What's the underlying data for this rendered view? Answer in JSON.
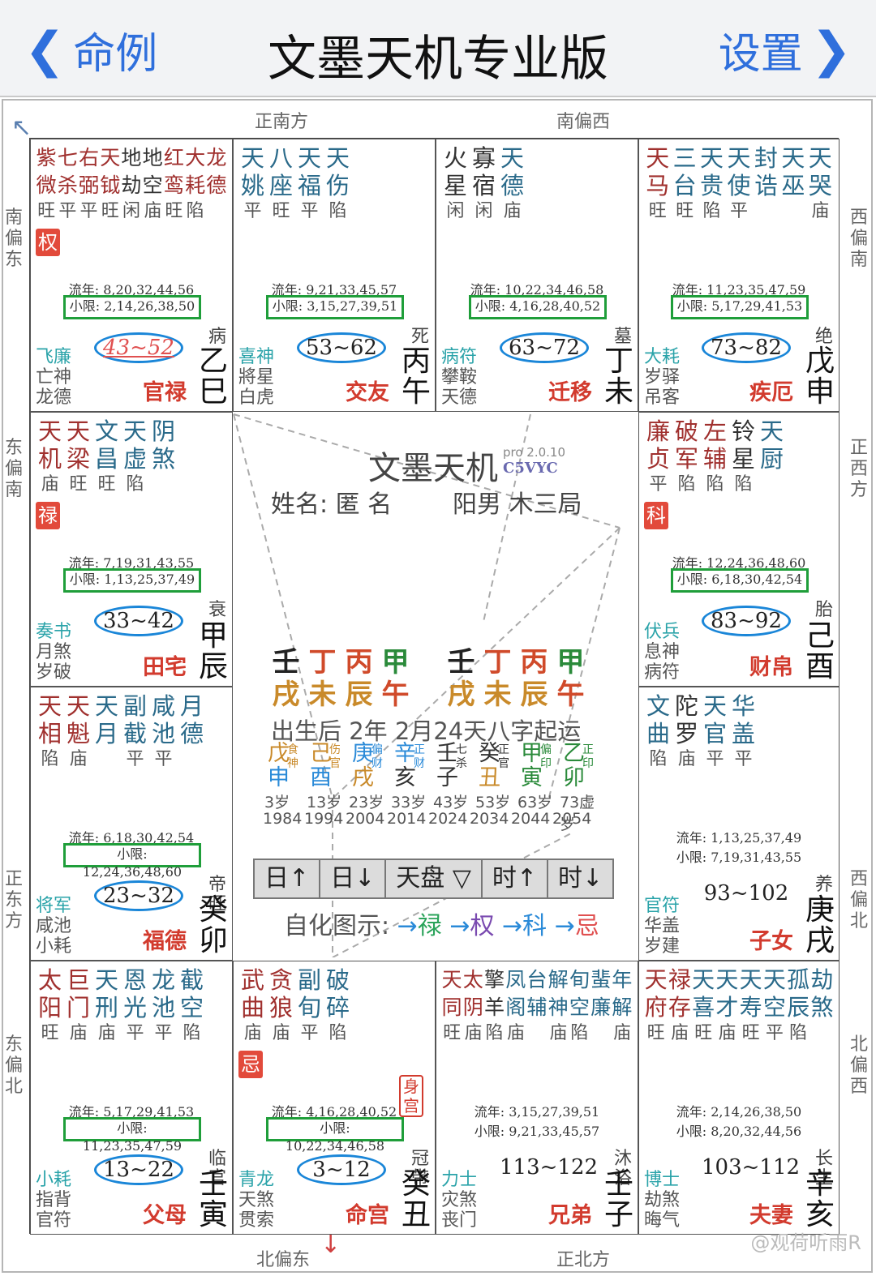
{
  "nav": {
    "back_label": "命例",
    "title": "文墨天机专业版",
    "settings_label": "设置"
  },
  "directions": {
    "top_left": "正南方",
    "top_right": "南偏西",
    "bottom_left": "北偏东",
    "bottom_right": "正北方",
    "left": [
      "南偏东",
      "东偏南",
      "正东方",
      "东偏北"
    ],
    "right": [
      "西偏南",
      "正西方",
      "西偏北",
      "北偏西"
    ]
  },
  "palaces": [
    {
      "id": "si",
      "stars": [
        {
          "c": "紫微",
          "col": "#a0302e"
        },
        {
          "c": "七杀",
          "col": "#a0302e"
        },
        {
          "c": "右弼",
          "col": "#a0302e"
        },
        {
          "c": "天钺",
          "col": "#a0302e"
        },
        {
          "c": "地劫",
          "col": "#333"
        },
        {
          "c": "地空",
          "col": "#333"
        },
        {
          "c": "红鸾",
          "col": "#a0302e"
        },
        {
          "c": "大耗",
          "col": "#a0302e"
        },
        {
          "c": "龙德",
          "col": "#a0302e"
        }
      ],
      "bright": [
        "旺",
        "平",
        "平",
        "旺",
        "闲",
        "庙",
        "旺",
        "陷",
        ""
      ],
      "hua": "权",
      "liunian": "流年: 8,20,32,44,56",
      "xiaoxian": "小限: 2,14,26,38,50",
      "range": "43~52",
      "changsheng": "病",
      "shensha": [
        "飞廉",
        "亡神",
        "龙德"
      ],
      "name": "官禄",
      "gan": "乙",
      "zhi": "巳"
    },
    {
      "id": "wu",
      "stars": [
        {
          "c": "天姚",
          "col": "#2a6a8a"
        },
        {
          "c": "八座",
          "col": "#2a6a8a"
        },
        {
          "c": "天福",
          "col": "#2a6a8a"
        },
        {
          "c": "天伤",
          "col": "#2a6a8a"
        }
      ],
      "bright": [
        "平",
        "旺",
        "平",
        "陷"
      ],
      "liunian": "流年: 9,21,33,45,57",
      "xiaoxian": "小限: 3,15,27,39,51",
      "range": "53~62",
      "changsheng": "死",
      "shensha": [
        "喜神",
        "將星",
        "白虎"
      ],
      "name": "交友",
      "gan": "丙",
      "zhi": "午"
    },
    {
      "id": "wei",
      "stars": [
        {
          "c": "火星",
          "col": "#333"
        },
        {
          "c": "寡宿",
          "col": "#333"
        },
        {
          "c": "天德",
          "col": "#2a6a8a"
        }
      ],
      "bright": [
        "闲",
        "闲",
        "庙"
      ],
      "liunian": "流年: 10,22,34,46,58",
      "xiaoxian": "小限: 4,16,28,40,52",
      "range": "63~72",
      "changsheng": "墓",
      "shensha": [
        "病符",
        "攀鞍",
        "天德"
      ],
      "name": "迁移",
      "gan": "丁",
      "zhi": "未"
    },
    {
      "id": "shen",
      "stars": [
        {
          "c": "天马",
          "col": "#a0302e"
        },
        {
          "c": "三台",
          "col": "#2a6a8a"
        },
        {
          "c": "天贵",
          "col": "#2a6a8a"
        },
        {
          "c": "天使",
          "col": "#2a6a8a"
        },
        {
          "c": "封诰",
          "col": "#2a6a8a"
        },
        {
          "c": "天巫",
          "col": "#2a6a8a"
        },
        {
          "c": "天哭",
          "col": "#2a6a8a"
        }
      ],
      "bright": [
        "旺",
        "旺",
        "陷",
        "平",
        "",
        "",
        "庙"
      ],
      "liunian": "流年: 11,23,35,47,59",
      "xiaoxian": "小限: 5,17,29,41,53",
      "range": "73~82",
      "changsheng": "绝",
      "shensha": [
        "大耗",
        "岁驿",
        "吊客"
      ],
      "name": "疾厄",
      "gan": "戊",
      "zhi": "申"
    },
    {
      "id": "chen",
      "stars": [
        {
          "c": "天机",
          "col": "#a0302e"
        },
        {
          "c": "天梁",
          "col": "#a0302e"
        },
        {
          "c": "文昌",
          "col": "#2a6a8a"
        },
        {
          "c": "天虚",
          "col": "#2a6a8a"
        },
        {
          "c": "阴煞",
          "col": "#2a6a8a"
        }
      ],
      "bright": [
        "庙",
        "旺",
        "旺",
        "陷",
        ""
      ],
      "hua": "禄",
      "liunian": "流年: 7,19,31,43,55",
      "xiaoxian": "小限: 1,13,25,37,49",
      "range": "33~42",
      "changsheng": "衰",
      "shensha": [
        "奏书",
        "月煞",
        "岁破"
      ],
      "name": "田宅",
      "gan": "甲",
      "zhi": "辰"
    },
    {
      "id": "you",
      "stars": [
        {
          "c": "廉贞",
          "col": "#a0302e"
        },
        {
          "c": "破军",
          "col": "#a0302e"
        },
        {
          "c": "左辅",
          "col": "#a0302e"
        },
        {
          "c": "铃星",
          "col": "#333"
        },
        {
          "c": "天厨",
          "col": "#2a6a8a"
        }
      ],
      "bright": [
        "平",
        "陷",
        "陷",
        "陷",
        ""
      ],
      "hua": "科",
      "liunian": "流年: 12,24,36,48,60",
      "xiaoxian": "小限: 6,18,30,42,54",
      "range": "83~92",
      "changsheng": "胎",
      "shensha": [
        "伏兵",
        "息神",
        "病符"
      ],
      "name": "财帛",
      "gan": "己",
      "zhi": "酉"
    },
    {
      "id": "mao",
      "stars": [
        {
          "c": "天相",
          "col": "#a0302e"
        },
        {
          "c": "天魁",
          "col": "#a0302e"
        },
        {
          "c": "天月",
          "col": "#2a6a8a"
        },
        {
          "c": "副截",
          "col": "#2a6a8a"
        },
        {
          "c": "咸池",
          "col": "#2a6a8a"
        },
        {
          "c": "月德",
          "col": "#2a6a8a"
        }
      ],
      "bright": [
        "陷",
        "庙",
        "",
        "平",
        "平",
        ""
      ],
      "liunian": "流年: 6,18,30,42,54",
      "xiaoxian": "小限: 12,24,36,48,60",
      "range": "23~32",
      "changsheng": "帝旺",
      "shensha": [
        "将军",
        "咸池",
        "小耗"
      ],
      "name": "福德",
      "gan": "癸",
      "zhi": "卯"
    },
    {
      "id": "xu",
      "stars": [
        {
          "c": "文曲",
          "col": "#2a6a8a"
        },
        {
          "c": "陀罗",
          "col": "#333"
        },
        {
          "c": "天官",
          "col": "#2a6a8a"
        },
        {
          "c": "华盖",
          "col": "#2a6a8a"
        }
      ],
      "bright": [
        "陷",
        "庙",
        "平",
        "平"
      ],
      "liunian": "流年: 1,13,25,37,49",
      "xiaoxian": "小限: 7,19,31,43,55",
      "range": "93~102",
      "changsheng": "养",
      "shensha": [
        "官符",
        "华盖",
        "岁建"
      ],
      "name": "子女",
      "gan": "庚",
      "zhi": "戌"
    },
    {
      "id": "yin",
      "stars": [
        {
          "c": "太阳",
          "col": "#a0302e"
        },
        {
          "c": "巨门",
          "col": "#a0302e"
        },
        {
          "c": "天刑",
          "col": "#2a6a8a"
        },
        {
          "c": "恩光",
          "col": "#2a6a8a"
        },
        {
          "c": "龙池",
          "col": "#2a6a8a"
        },
        {
          "c": "截空",
          "col": "#2a6a8a"
        }
      ],
      "bright": [
        "旺",
        "庙",
        "庙",
        "平",
        "平",
        "陷"
      ],
      "liunian": "流年: 5,17,29,41,53",
      "xiaoxian": "小限: 11,23,35,47,59",
      "range": "13~22",
      "changsheng": "临官",
      "shensha": [
        "小耗",
        "指背",
        "官符"
      ],
      "name": "父母",
      "gan": "壬",
      "zhi": "寅"
    },
    {
      "id": "chou",
      "stars": [
        {
          "c": "武曲",
          "col": "#a0302e"
        },
        {
          "c": "贪狼",
          "col": "#a0302e"
        },
        {
          "c": "副旬",
          "col": "#2a6a8a"
        },
        {
          "c": "破碎",
          "col": "#2a6a8a"
        }
      ],
      "bright": [
        "庙",
        "庙",
        "平",
        "陷"
      ],
      "hua": "忌",
      "shengong": "身宫",
      "liunian": "流年: 4,16,28,40,52",
      "xiaoxian": "小限: 10,22,34,46,58",
      "range": "3~12",
      "changsheng": "冠带",
      "shensha": [
        "青龙",
        "天煞",
        "贯索"
      ],
      "name": "命宫",
      "gan": "癸",
      "zhi": "丑"
    },
    {
      "id": "zi",
      "stars": [
        {
          "c": "天同",
          "col": "#a0302e"
        },
        {
          "c": "太阴",
          "col": "#a0302e"
        },
        {
          "c": "擎羊",
          "col": "#333"
        },
        {
          "c": "凤阁",
          "col": "#2a6a8a"
        },
        {
          "c": "台辅",
          "col": "#2a6a8a"
        },
        {
          "c": "解神",
          "col": "#2a6a8a"
        },
        {
          "c": "旬空",
          "col": "#2a6a8a"
        },
        {
          "c": "蜚廉",
          "col": "#2a6a8a"
        },
        {
          "c": "年解",
          "col": "#2a6a8a"
        }
      ],
      "bright": [
        "旺",
        "庙",
        "陷",
        "庙",
        "",
        "庙",
        "陷",
        "",
        "庙"
      ],
      "liunian": "流年: 3,15,27,39,51",
      "xiaoxian": "小限: 9,21,33,45,57",
      "range": "113~122",
      "changsheng": "沐浴",
      "shensha": [
        "力士",
        "灾煞",
        "丧门"
      ],
      "name": "兄弟",
      "gan": "壬",
      "zhi": "子"
    },
    {
      "id": "hai",
      "stars": [
        {
          "c": "天府",
          "col": "#a0302e"
        },
        {
          "c": "禄存",
          "col": "#a0302e"
        },
        {
          "c": "天喜",
          "col": "#2a6a8a"
        },
        {
          "c": "天才",
          "col": "#2a6a8a"
        },
        {
          "c": "天寿",
          "col": "#2a6a8a"
        },
        {
          "c": "天空",
          "col": "#2a6a8a"
        },
        {
          "c": "孤辰",
          "col": "#2a6a8a"
        },
        {
          "c": "劫煞",
          "col": "#2a6a8a"
        }
      ],
      "bright": [
        "旺",
        "庙",
        "旺",
        "庙",
        "旺",
        "平",
        "陷",
        ""
      ],
      "liunian": "流年: 2,14,26,38,50",
      "xiaoxian": "小限: 8,20,32,44,56",
      "range": "103~112",
      "changsheng": "长生",
      "shensha": [
        "博士",
        "劫煞",
        "晦气"
      ],
      "name": "夫妻",
      "gan": "辛",
      "zhi": "亥"
    }
  ],
  "center": {
    "brand": "文墨天机",
    "version": "pro 2.0.10",
    "code": "C5VYC",
    "name_label": "姓名: 匿 名",
    "info": "阳男 木三局",
    "bazi_left": {
      "gan": [
        "壬",
        "丁",
        "丙",
        "甲"
      ],
      "zhi": [
        "戌",
        "未",
        "辰",
        "午"
      ]
    },
    "bazi_right": {
      "gan": [
        "壬",
        "丁",
        "丙",
        "甲"
      ],
      "zhi": [
        "戌",
        "未",
        "辰",
        "午"
      ]
    },
    "qiyun": "出生后 2年 2月24天八字起运",
    "dayun": [
      {
        "g": "戊",
        "z": "申",
        "t1": "食神",
        "gc": "#c98a2a",
        "zc": "#2a8ad8"
      },
      {
        "g": "己",
        "z": "酉",
        "t1": "伤官",
        "gc": "#c98a2a",
        "zc": "#2a8ad8"
      },
      {
        "g": "庚",
        "z": "戌",
        "t1": "偏财",
        "gc": "#2a8ad8",
        "zc": "#c98a2a"
      },
      {
        "g": "辛",
        "z": "亥",
        "t1": "正财",
        "gc": "#2a8ad8",
        "zc": "#333"
      },
      {
        "g": "壬",
        "z": "子",
        "t1": "七杀",
        "gc": "#333",
        "zc": "#333"
      },
      {
        "g": "癸",
        "z": "丑",
        "t1": "正官",
        "gc": "#333",
        "zc": "#c98a2a"
      },
      {
        "g": "甲",
        "z": "寅",
        "t1": "偏印",
        "gc": "#2a8a3a",
        "zc": "#2a8a3a"
      },
      {
        "g": "乙",
        "z": "卯",
        "t1": "正印",
        "gc": "#2a8a3a",
        "zc": "#2a8a3a"
      }
    ],
    "ages": [
      "3岁",
      "13岁",
      "23岁",
      "33岁",
      "43岁",
      "53岁",
      "63岁",
      "73虚岁"
    ],
    "years": [
      "1984",
      "1994",
      "2004",
      "2014",
      "2024",
      "2034",
      "2044",
      "2054"
    ],
    "buttons": [
      "日↑",
      "日↓",
      "天盘 ▽",
      "时↑",
      "时↓"
    ],
    "hua_legend_label": "自化图示:",
    "hua_items": [
      "禄",
      "权",
      "科",
      "忌"
    ],
    "hua_arrow": "→"
  },
  "watermark": "@观荷听雨R",
  "colors": {
    "accent": "#2f6fdc",
    "palace_name": "#d23b2e",
    "xiaoxian_border": "#1f9e3a",
    "range_ring": "#1a86d8"
  }
}
